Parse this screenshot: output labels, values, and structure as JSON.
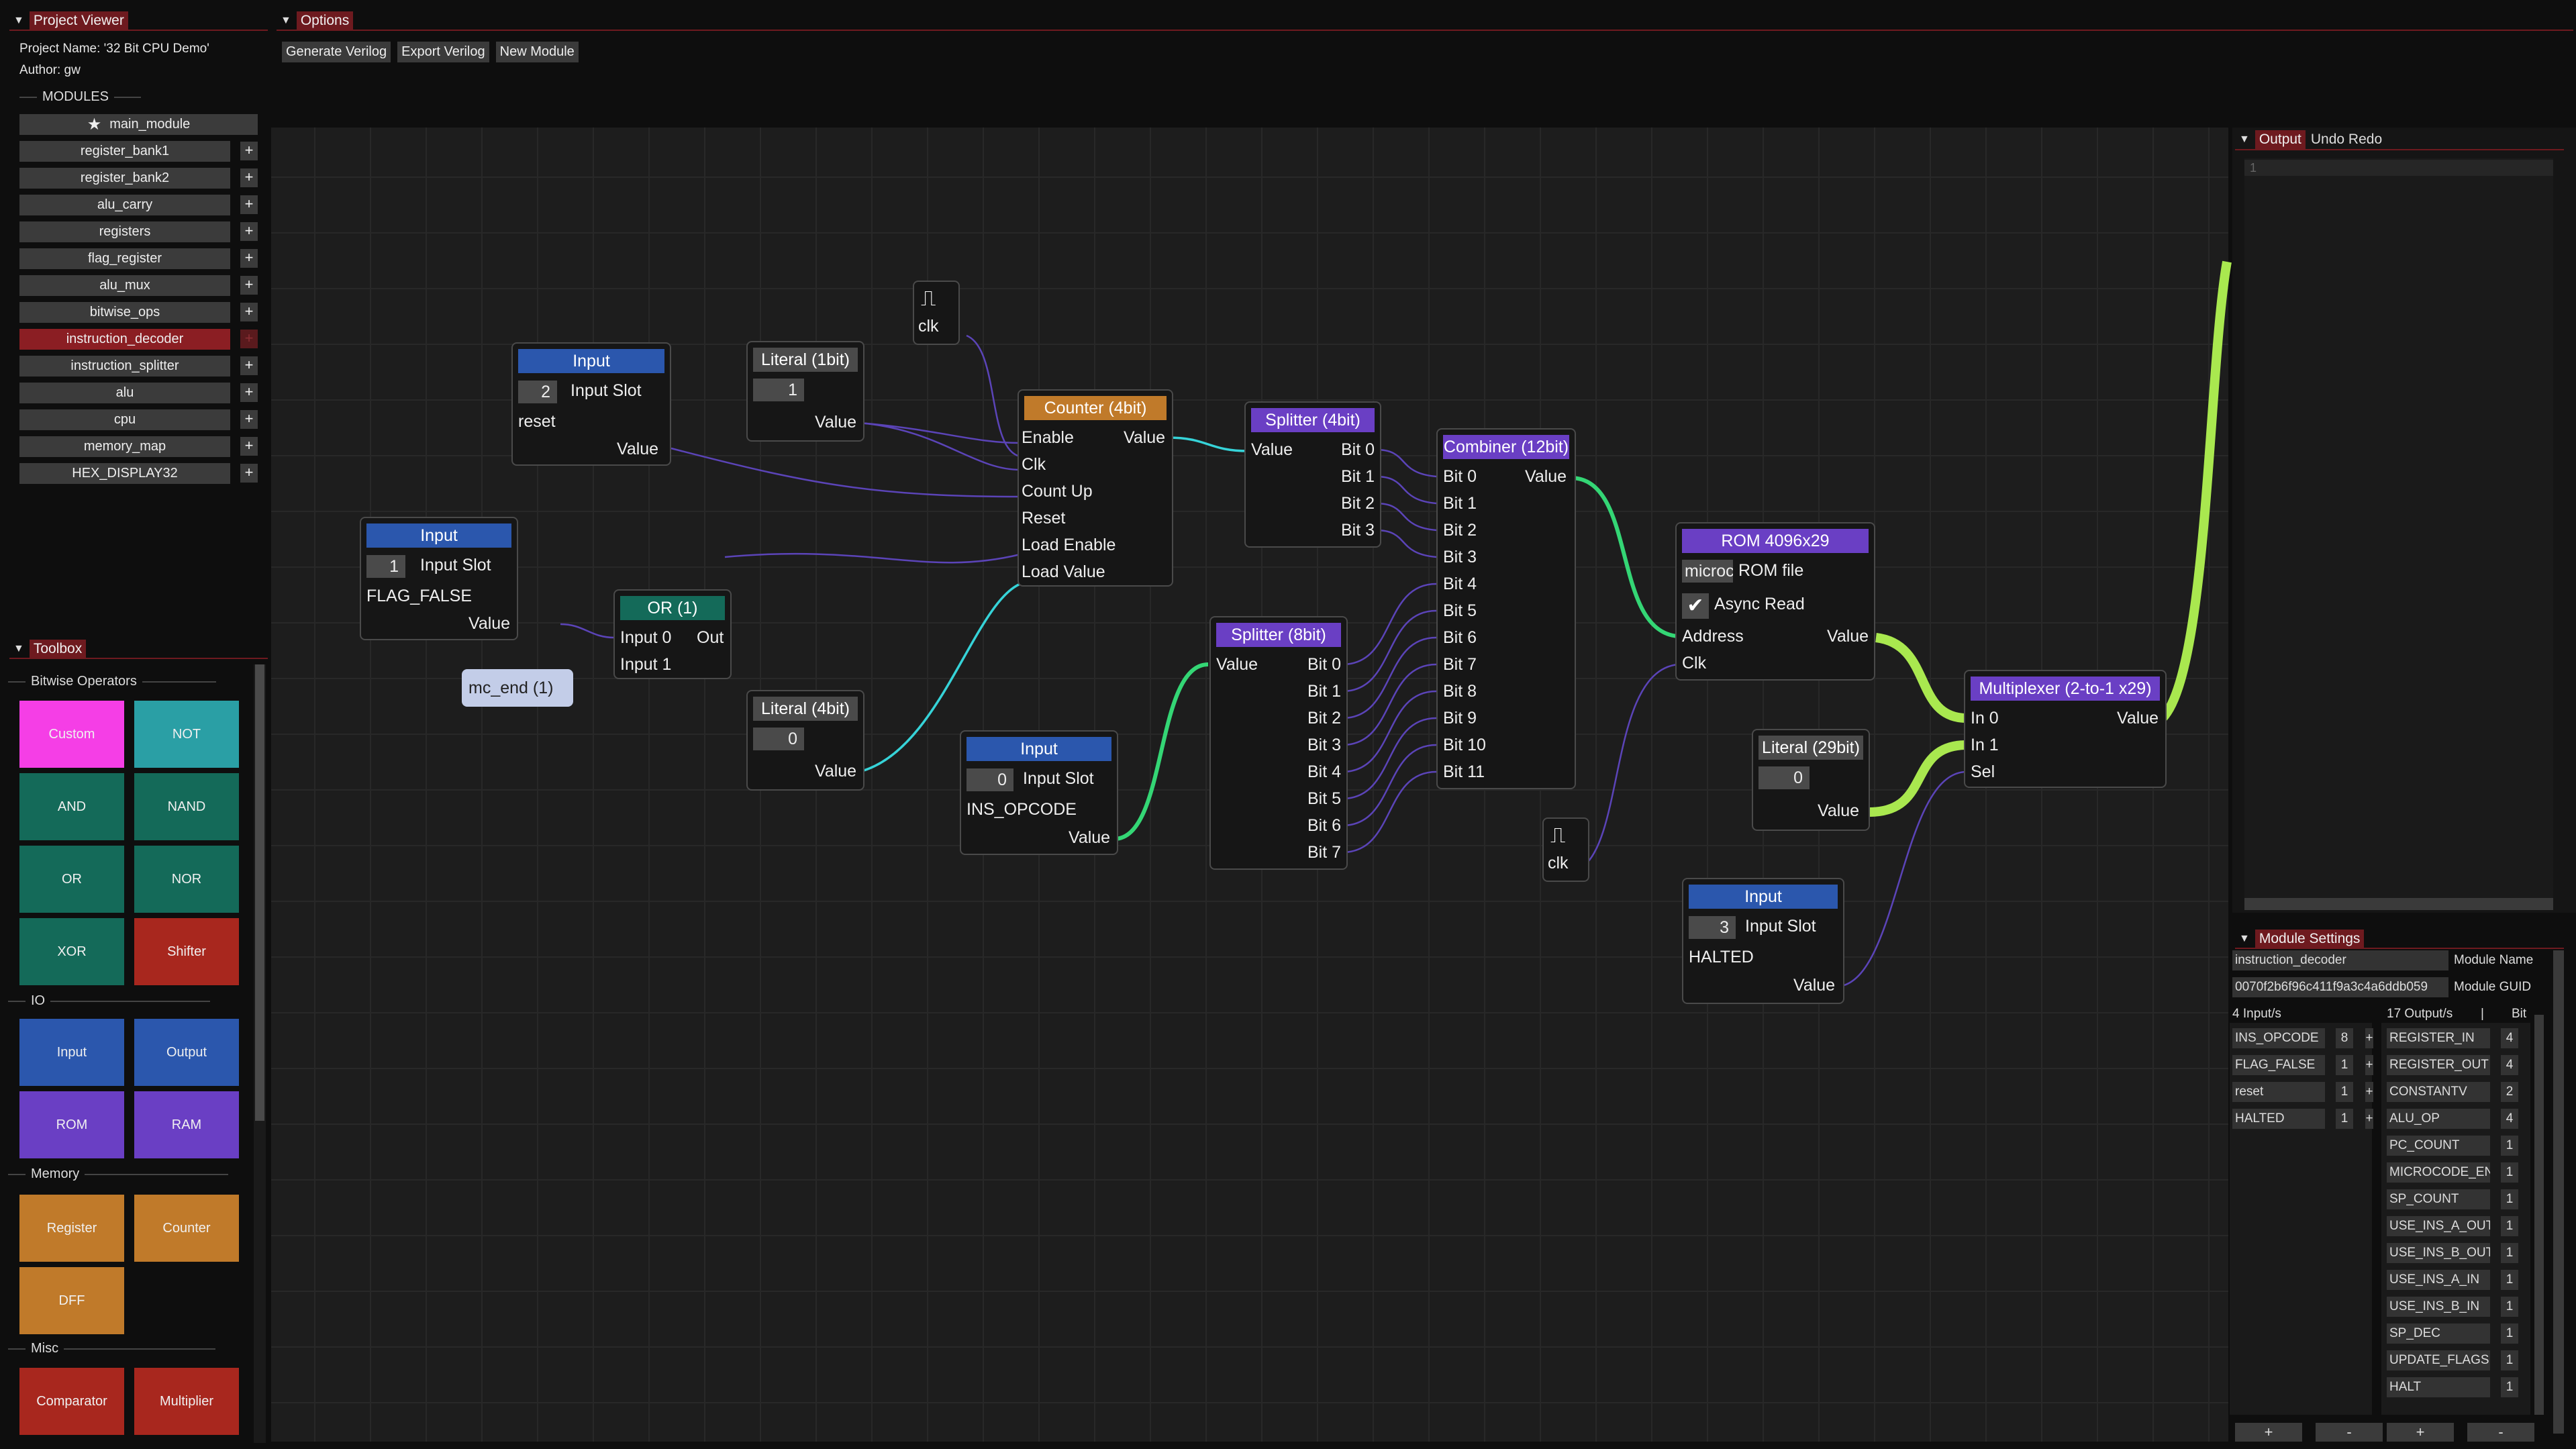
{
  "project_viewer": {
    "title": "Project Viewer",
    "project_name": "Project Name: '32 Bit CPU Demo'",
    "author": "Author: gw",
    "modules_label": "MODULES",
    "main_module": "main_module",
    "modules": [
      "register_bank1",
      "register_bank2",
      "alu_carry",
      "registers",
      "flag_register",
      "alu_mux",
      "bitwise_ops",
      "instruction_decoder",
      "instruction_splitter",
      "alu",
      "cpu",
      "memory_map",
      "HEX_DISPLAY32"
    ],
    "selected_module": "instruction_decoder",
    "plus": "+"
  },
  "options": {
    "title": "Options",
    "buttons": [
      "Generate Verilog",
      "Export Verilog",
      "New Module"
    ]
  },
  "toolbox": {
    "title": "Toolbox",
    "sections": [
      {
        "label": "Bitwise Operators",
        "items": [
          "Custom",
          "NOT",
          "AND",
          "NAND",
          "OR",
          "NOR",
          "XOR",
          "Shifter"
        ]
      },
      {
        "label": "IO",
        "items": [
          "Input",
          "Output",
          "ROM",
          "RAM"
        ]
      },
      {
        "label": "Memory",
        "items": [
          "Register",
          "Counter",
          "DFF"
        ]
      },
      {
        "label": "Misc",
        "items": [
          "Comparator",
          "Multiplier"
        ]
      }
    ],
    "colors": {
      "Custom": "#f53ee6",
      "NOT": "#2a9fa5",
      "AND": "#146a59",
      "NAND": "#146a59",
      "OR": "#146a59",
      "NOR": "#146a59",
      "XOR": "#146a59",
      "Shifter": "#a8271e",
      "Input": "#2b57ad",
      "Output": "#2b57ad",
      "ROM": "#6a3fc4",
      "RAM": "#6a3fc4",
      "Register": "#c07a2a",
      "Counter": "#c07a2a",
      "DFF": "#c07a2a",
      "Comparator": "#a8271e",
      "Multiplier": "#a8271e"
    }
  },
  "output_panel": {
    "tabs": [
      "Output",
      "Undo Redo"
    ],
    "line": "1"
  },
  "module_settings": {
    "title": "Module Settings",
    "module_name": "instruction_decoder",
    "module_name_label": "Module Name",
    "guid": "0070f2b6f96c411f9a3c4a6ddb059",
    "guid_label": "Module GUID",
    "inputs_label": "4 Input/s",
    "outputs_label": "17 Output/s",
    "sep": "|",
    "bit_label": "Bit",
    "inputs": [
      {
        "name": "INS_OPCODE",
        "bits": "8"
      },
      {
        "name": "FLAG_FALSE",
        "bits": "1"
      },
      {
        "name": "reset",
        "bits": "1"
      },
      {
        "name": "HALTED",
        "bits": "1"
      }
    ],
    "outputs": [
      {
        "name": "REGISTER_IN",
        "bits": "4"
      },
      {
        "name": "REGISTER_OUT",
        "bits": "4"
      },
      {
        "name": "CONSTANTV",
        "bits": "2"
      },
      {
        "name": "ALU_OP",
        "bits": "4"
      },
      {
        "name": "PC_COUNT",
        "bits": "1"
      },
      {
        "name": "MICROCODE_EN",
        "bits": "1"
      },
      {
        "name": "SP_COUNT",
        "bits": "1"
      },
      {
        "name": "USE_INS_A_OUT",
        "bits": "1"
      },
      {
        "name": "USE_INS_B_OUT",
        "bits": "1"
      },
      {
        "name": "USE_INS_A_IN",
        "bits": "1"
      },
      {
        "name": "USE_INS_B_IN",
        "bits": "1"
      },
      {
        "name": "SP_DEC",
        "bits": "1"
      },
      {
        "name": "UPDATE_FLAGS",
        "bits": "1"
      },
      {
        "name": "HALT",
        "bits": "1"
      }
    ],
    "add": "+",
    "remove": "-"
  },
  "nodes": {
    "input_reset": {
      "title": "Input",
      "slot": "2",
      "slot_label": "Input Slot",
      "name": "reset",
      "value": "Value"
    },
    "input_flag": {
      "title": "Input",
      "slot": "1",
      "slot_label": "Input Slot",
      "name": "FLAG_FALSE",
      "value": "Value"
    },
    "or": {
      "title": "OR (1)",
      "in0": "Input 0",
      "in1": "Input 1",
      "out": "Out"
    },
    "mc_end": "mc_end (1)",
    "literal_1bit": {
      "title": "Literal (1bit)",
      "val": "1",
      "value": "Value"
    },
    "literal_4bit": {
      "title": "Literal (4bit)",
      "val": "0",
      "value": "Value"
    },
    "clk1": "clk",
    "clk2": "clk",
    "counter": {
      "title": "Counter (4bit)",
      "pins": [
        "Enable",
        "Clk",
        "Count Up",
        "Reset",
        "Load Enable",
        "Load Value"
      ],
      "value": "Value"
    },
    "splitter4": {
      "title": "Splitter (4bit)",
      "value": "Value",
      "bits": [
        "Bit 0",
        "Bit 1",
        "Bit 2",
        "Bit 3"
      ]
    },
    "input_opcode": {
      "title": "Input",
      "slot": "0",
      "slot_label": "Input Slot",
      "name": "INS_OPCODE",
      "value": "Value"
    },
    "splitter8": {
      "title": "Splitter (8bit)",
      "value": "Value",
      "bits": [
        "Bit 0",
        "Bit 1",
        "Bit 2",
        "Bit 3",
        "Bit 4",
        "Bit 5",
        "Bit 6",
        "Bit 7"
      ]
    },
    "combiner": {
      "title": "Combiner (12bit)",
      "value": "Value",
      "bits": [
        "Bit 0",
        "Bit 1",
        "Bit 2",
        "Bit 3",
        "Bit 4",
        "Bit 5",
        "Bit 6",
        "Bit 7",
        "Bit 8",
        "Bit 9",
        "Bit 10",
        "Bit 11"
      ]
    },
    "rom": {
      "title": "ROM 4096x29",
      "file": "microc",
      "file_label": "ROM file",
      "async": "Async Read",
      "address": "Address",
      "clk": "Clk",
      "value": "Value"
    },
    "literal_29bit": {
      "title": "Literal (29bit)",
      "val": "0",
      "value": "Value"
    },
    "input_halted": {
      "title": "Input",
      "slot": "3",
      "slot_label": "Input Slot",
      "name": "HALTED",
      "value": "Value"
    },
    "mux": {
      "title": "Multiplexer (2-to-1 x29)",
      "in0": "In 0",
      "in1": "In 1",
      "sel": "Sel",
      "value": "Value"
    }
  }
}
